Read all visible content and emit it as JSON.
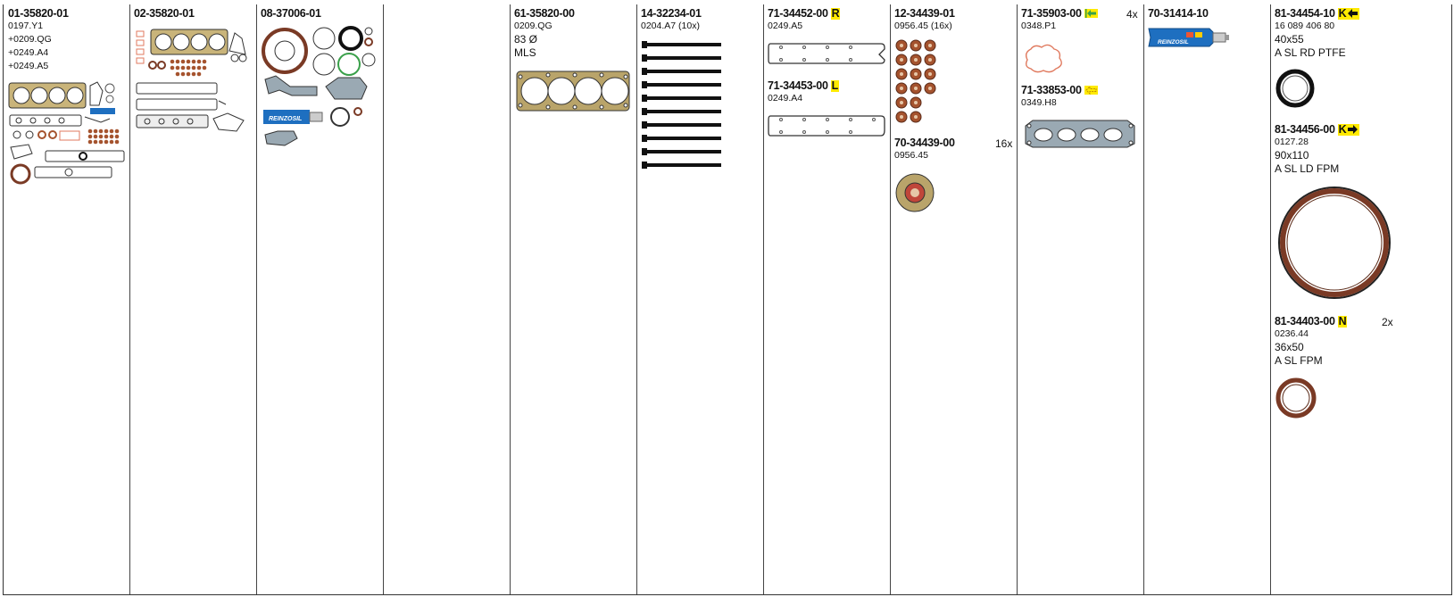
{
  "columns": [
    {
      "part": "01-35820-01",
      "lines": [
        "0197.Y1",
        "+0209.QG",
        "+0249.A4",
        "+0249.A5"
      ]
    },
    {
      "part": "02-35820-01",
      "lines": []
    },
    {
      "part": "08-37006-01",
      "lines": []
    },
    {
      "part": "",
      "lines": []
    },
    {
      "part": "61-35820-00",
      "lines": [
        "0209.QG"
      ],
      "specs": [
        "83 Ø",
        "MLS"
      ]
    },
    {
      "part": "14-32234-01",
      "lines": [
        "0204.A7 (10x)"
      ]
    },
    {
      "items": [
        {
          "part": "71-34452-00",
          "mark": "R",
          "code": "0249.A5"
        },
        {
          "part": "71-34453-00",
          "mark": "L",
          "code": "0249.A4"
        }
      ]
    },
    {
      "items": [
        {
          "part": "12-34439-01",
          "code": "0956.45 (16x)"
        },
        {
          "part": "70-34439-00",
          "code": "0956.45",
          "qty": "16x"
        }
      ]
    },
    {
      "items": [
        {
          "part": "71-35903-00",
          "code": "0348.P1",
          "qty": "4x",
          "icon": "arrow-left-bar-icon"
        },
        {
          "part": "71-33853-00",
          "code": "0349.H8",
          "icon": "arrow-left-dashed-icon"
        }
      ]
    },
    {
      "part": "70-31414-10",
      "lines": []
    },
    {
      "items": [
        {
          "part": "81-34454-10",
          "mark": "K",
          "icon": "arrow-left-icon",
          "code": "16 089 406 80",
          "specs": [
            "40x55",
            "A SL RD PTFE"
          ]
        },
        {
          "part": "81-34456-00",
          "mark": "K",
          "icon": "arrow-right-icon",
          "code": "0127.28",
          "specs": [
            "90x110",
            "A SL LD FPM"
          ]
        },
        {
          "part": "81-34403-00",
          "mark": "N",
          "code": "0236.44",
          "specs": [
            "36x50",
            "A SL FPM"
          ],
          "qty": "2x"
        }
      ]
    }
  ],
  "tube_brand": "REINZOSIL",
  "colors": {
    "highlight": "#ffea00",
    "seal_brown": "#7a3a25",
    "gasket_gold": "#b9a46a",
    "tube_blue": "#1e6fc0",
    "green_ring": "#3aa04a"
  }
}
